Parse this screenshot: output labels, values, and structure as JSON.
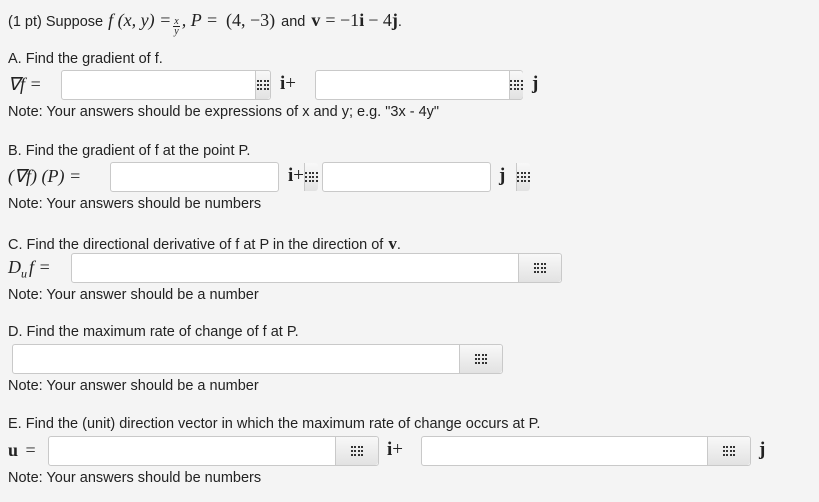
{
  "header": {
    "points": "(1 pt) Suppose",
    "func": "f (x, y) =",
    "frac_num": "x",
    "frac_den": "y",
    "p_label": ", P =",
    "p_value": "(4, −3)",
    "and": "and",
    "v_label": "v",
    "v_eq": "= −1",
    "i": "i",
    "minus": "− 4",
    "j": "j",
    "period": "."
  },
  "partA": {
    "label": "A. Find the gradient of f.",
    "lhs": "∇f =",
    "i_unit": "i",
    "plus": "+",
    "j_unit": "j",
    "note": "Note: Your answers should be expressions of x and y; e.g. \"3x - 4y\"",
    "input1": "",
    "input2": ""
  },
  "partB": {
    "label": "B. Find the gradient of f at the point P.",
    "lhs": "(∇f) (P) =",
    "i_unit": "i",
    "plus": "+",
    "j_unit": "j",
    "note": "Note: Your answers should be numbers",
    "input1": "",
    "input2": ""
  },
  "partC": {
    "label": "C. Find the directional derivative of f at P in the direction of",
    "v": "v",
    "period": ".",
    "lhs_D": "D",
    "lhs_sub": "u",
    "lhs_rest": "f =",
    "note": "Note: Your answer should be a number",
    "input1": ""
  },
  "partD": {
    "label": "D. Find the maximum rate of change of f at P.",
    "note": "Note: Your answer should be a number",
    "input1": ""
  },
  "partE": {
    "label": "E. Find the (unit) direction vector in which the maximum rate of change occurs at P.",
    "lhs_u": "u",
    "lhs_eq": "=",
    "i_unit": "i",
    "plus": "+",
    "j_unit": "j",
    "note": "Note: Your answers should be numbers",
    "input1": "",
    "input2": ""
  },
  "icons": {
    "palette": "equation-palette-icon"
  }
}
